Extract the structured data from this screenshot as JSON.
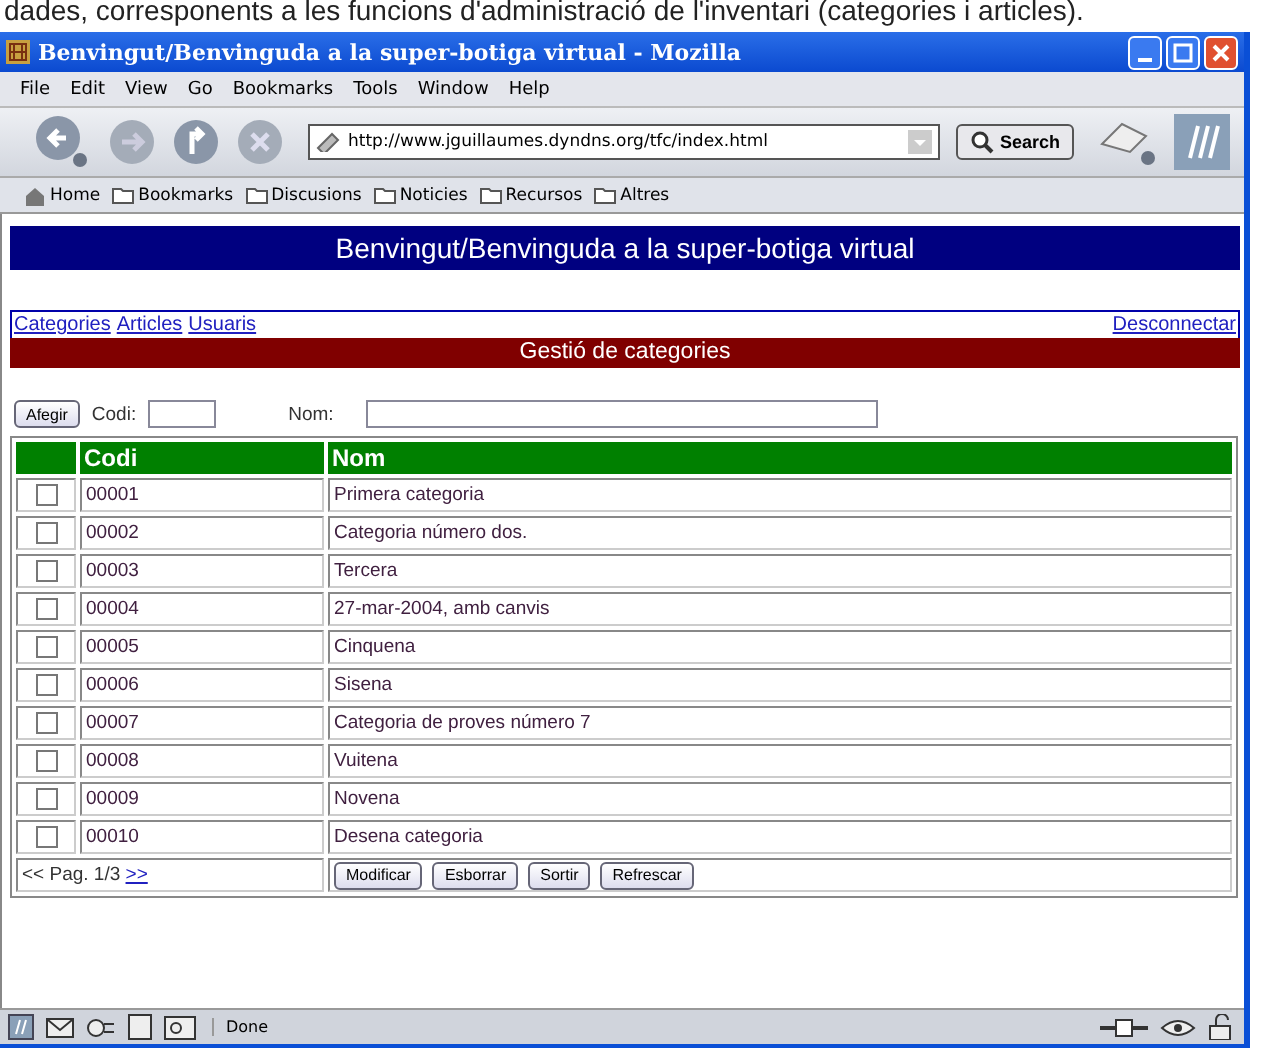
{
  "caption": "dades, corresponents a les funcions d'administració de l'inventari (categories i articles).",
  "window": {
    "title": "Benvingut/Benvinguda a la super-botiga virtual - Mozilla"
  },
  "menu": [
    "File",
    "Edit",
    "View",
    "Go",
    "Bookmarks",
    "Tools",
    "Window",
    "Help"
  ],
  "navigation": {
    "url": "http://www.jguillaumes.dyndns.org/tfc/index.html",
    "search_button": "Search"
  },
  "bookmarks": [
    {
      "kind": "home",
      "label": "Home"
    },
    {
      "kind": "folder",
      "label": "Bookmarks"
    },
    {
      "kind": "folder",
      "label": "Discusions"
    },
    {
      "kind": "folder",
      "label": "Noticies"
    },
    {
      "kind": "folder",
      "label": "Recursos"
    },
    {
      "kind": "folder",
      "label": "Altres"
    }
  ],
  "page": {
    "banner": "Benvingut/Benvinguda a la super-botiga virtual",
    "nav_links": [
      "Categories",
      "Articles",
      "Usuaris"
    ],
    "logout_link": "Desconnectar",
    "section_title": "Gestió de categories",
    "form": {
      "add_button": "Afegir",
      "codi_label": "Codi:",
      "nom_label": "Nom:"
    },
    "table": {
      "columns": [
        "Codi",
        "Nom"
      ],
      "rows": [
        {
          "checked": false,
          "codi": "00001",
          "nom": "Primera categoria"
        },
        {
          "checked": false,
          "codi": "00002",
          "nom": "Categoria número dos."
        },
        {
          "checked": false,
          "codi": "00003",
          "nom": "Tercera"
        },
        {
          "checked": false,
          "codi": "00004",
          "nom": "27-mar-2004, amb canvis"
        },
        {
          "checked": false,
          "codi": "00005",
          "nom": "Cinquena"
        },
        {
          "checked": false,
          "codi": "00006",
          "nom": "Sisena"
        },
        {
          "checked": false,
          "codi": "00007",
          "nom": "Categoria de proves número 7"
        },
        {
          "checked": false,
          "codi": "00008",
          "nom": "Vuitena"
        },
        {
          "checked": false,
          "codi": "00009",
          "nom": "Novena"
        },
        {
          "checked": false,
          "codi": "00010",
          "nom": "Desena categoria"
        }
      ],
      "pager": "<< Pag. 1/3",
      "next_link": ">>",
      "buttons": [
        "Modificar",
        "Esborrar",
        "Sortir",
        "Refrescar"
      ]
    }
  },
  "status_bar": {
    "text": "Done"
  }
}
